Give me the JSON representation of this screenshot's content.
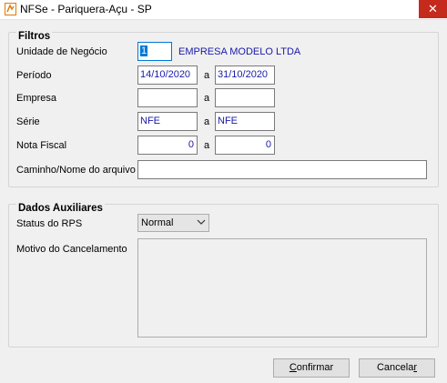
{
  "window": {
    "title": "NFSe - Pariquera-Açu - SP",
    "close_glyph": "✕"
  },
  "filtros": {
    "title": "Filtros",
    "unidade": {
      "label": "Unidade de Negócio",
      "code": "1",
      "name": "EMPRESA MODELO LTDA"
    },
    "periodo": {
      "label": "Período",
      "from": "14/10/2020",
      "sep": "a",
      "to": "31/10/2020"
    },
    "empresa": {
      "label": "Empresa",
      "from": "",
      "sep": "a",
      "to": ""
    },
    "serie": {
      "label": "Série",
      "from": "NFE",
      "sep": "a",
      "to": "NFE"
    },
    "nota_fiscal": {
      "label": "Nota Fiscal",
      "from": "0",
      "sep": "a",
      "to": "0"
    },
    "caminho": {
      "label": "Caminho/Nome do arquivo",
      "value": ""
    }
  },
  "auxiliares": {
    "title": "Dados Auxiliares",
    "status": {
      "label": "Status do RPS",
      "value": "Normal"
    },
    "motivo": {
      "label": "Motivo do Cancelamento",
      "value": ""
    }
  },
  "buttons": {
    "confirmar": {
      "label_accel": "C",
      "label_rest": "onfirmar"
    },
    "cancelar": {
      "label_main": "Cancela",
      "label_accel": "r"
    }
  },
  "colors": {
    "accent": "#0078d7",
    "close": "#c42b1c",
    "value_text": "#1a1aa8"
  }
}
